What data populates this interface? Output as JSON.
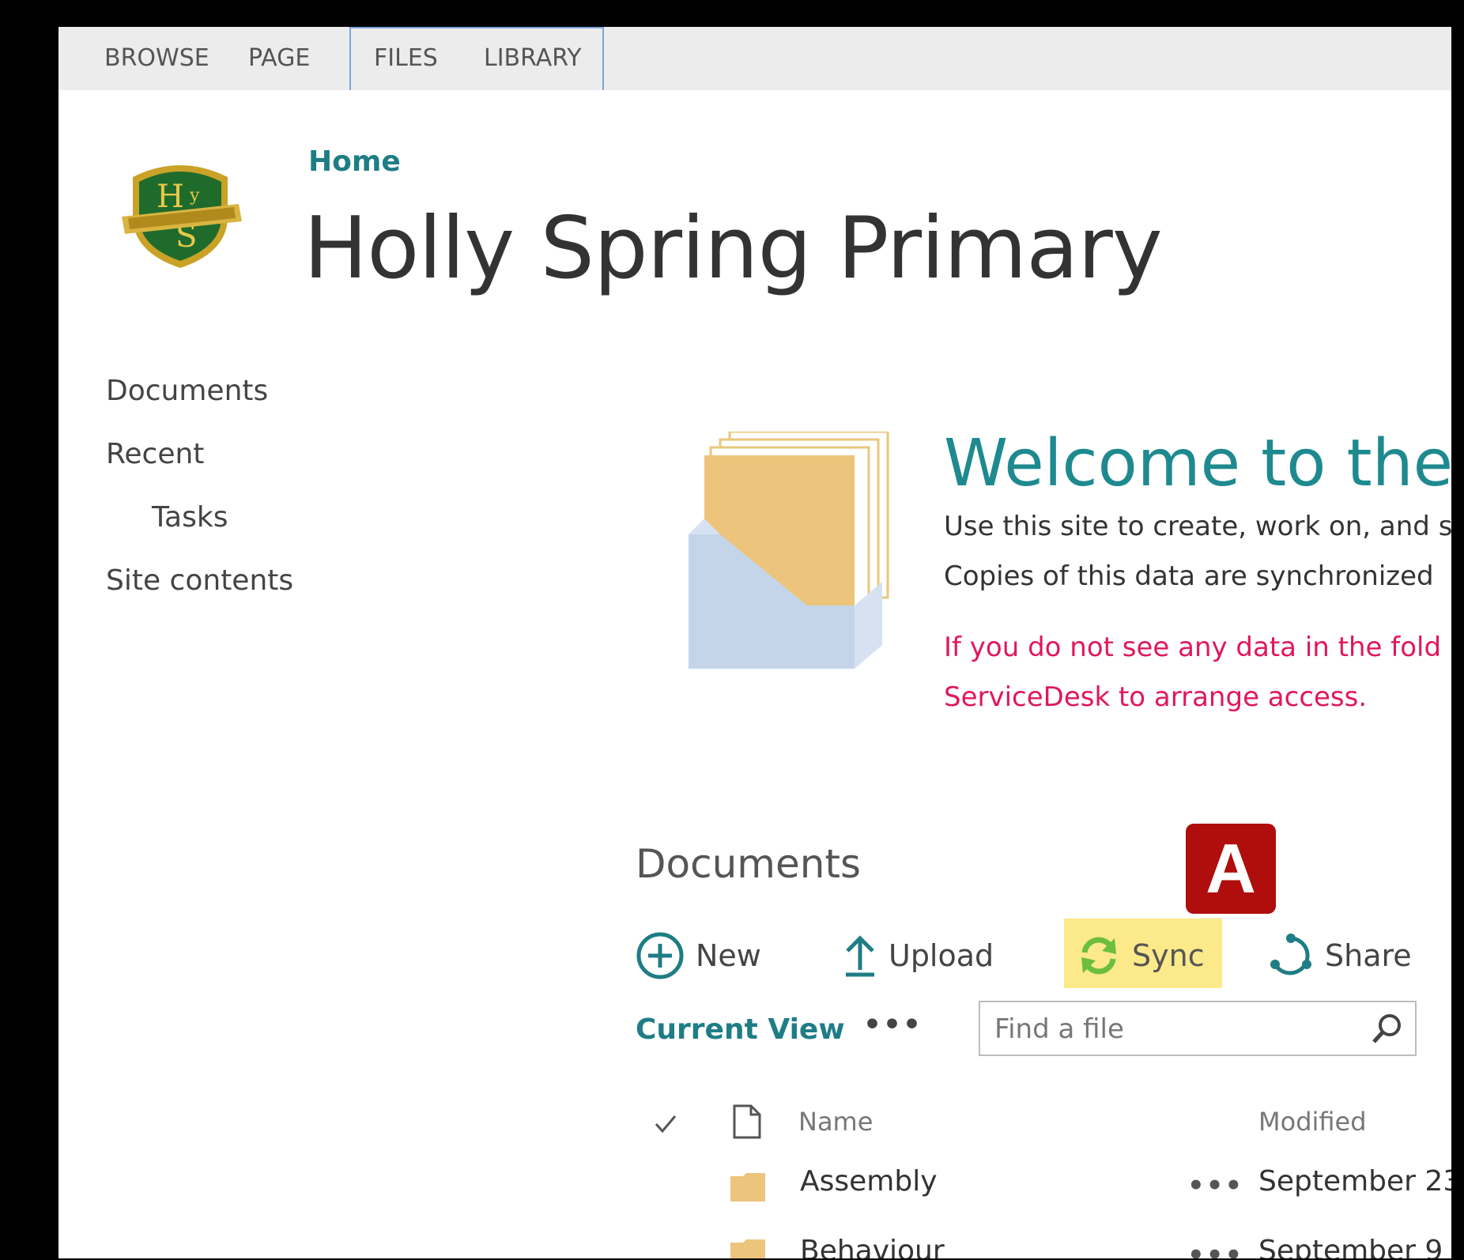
{
  "ribbon": {
    "tabs": [
      {
        "label": "BROWSE"
      },
      {
        "label": "PAGE"
      },
      {
        "label": "FILES"
      },
      {
        "label": "LIBRARY"
      }
    ]
  },
  "header": {
    "breadcrumb": "Home",
    "site_title": "Holly Spring Primary",
    "logo_icon": "school-crest-icon"
  },
  "nav": {
    "items": [
      {
        "label": "Documents"
      },
      {
        "label": "Recent"
      },
      {
        "label": "Tasks"
      },
      {
        "label": "Site contents"
      }
    ]
  },
  "welcome": {
    "title": "Welcome to the",
    "line1": "Use this site to create, work on, and s",
    "line2": "Copies of this data are synchronized",
    "warning_line1": "If you do not see any data in the fold",
    "warning_line2": "ServiceDesk to arrange access."
  },
  "documents": {
    "heading": "Documents",
    "commands": {
      "new": "New",
      "upload": "Upload",
      "sync": "Sync",
      "share": "Share"
    },
    "callout_badge": "A",
    "current_view": "Current View",
    "view_more": "•••",
    "search_placeholder": "Find a file",
    "columns": {
      "name": "Name",
      "modified": "Modified"
    },
    "rows": [
      {
        "name": "Assembly",
        "modified": "September 23",
        "more": "•••"
      },
      {
        "name": "Behaviour",
        "modified": "September 9",
        "more": "•••"
      }
    ]
  },
  "colors": {
    "accent_teal": "#1e7d85",
    "warning_red": "#e0185a",
    "highlight_yellow": "#fbe98a",
    "badge_red": "#b00d0d",
    "sync_green": "#6cbf3c"
  }
}
